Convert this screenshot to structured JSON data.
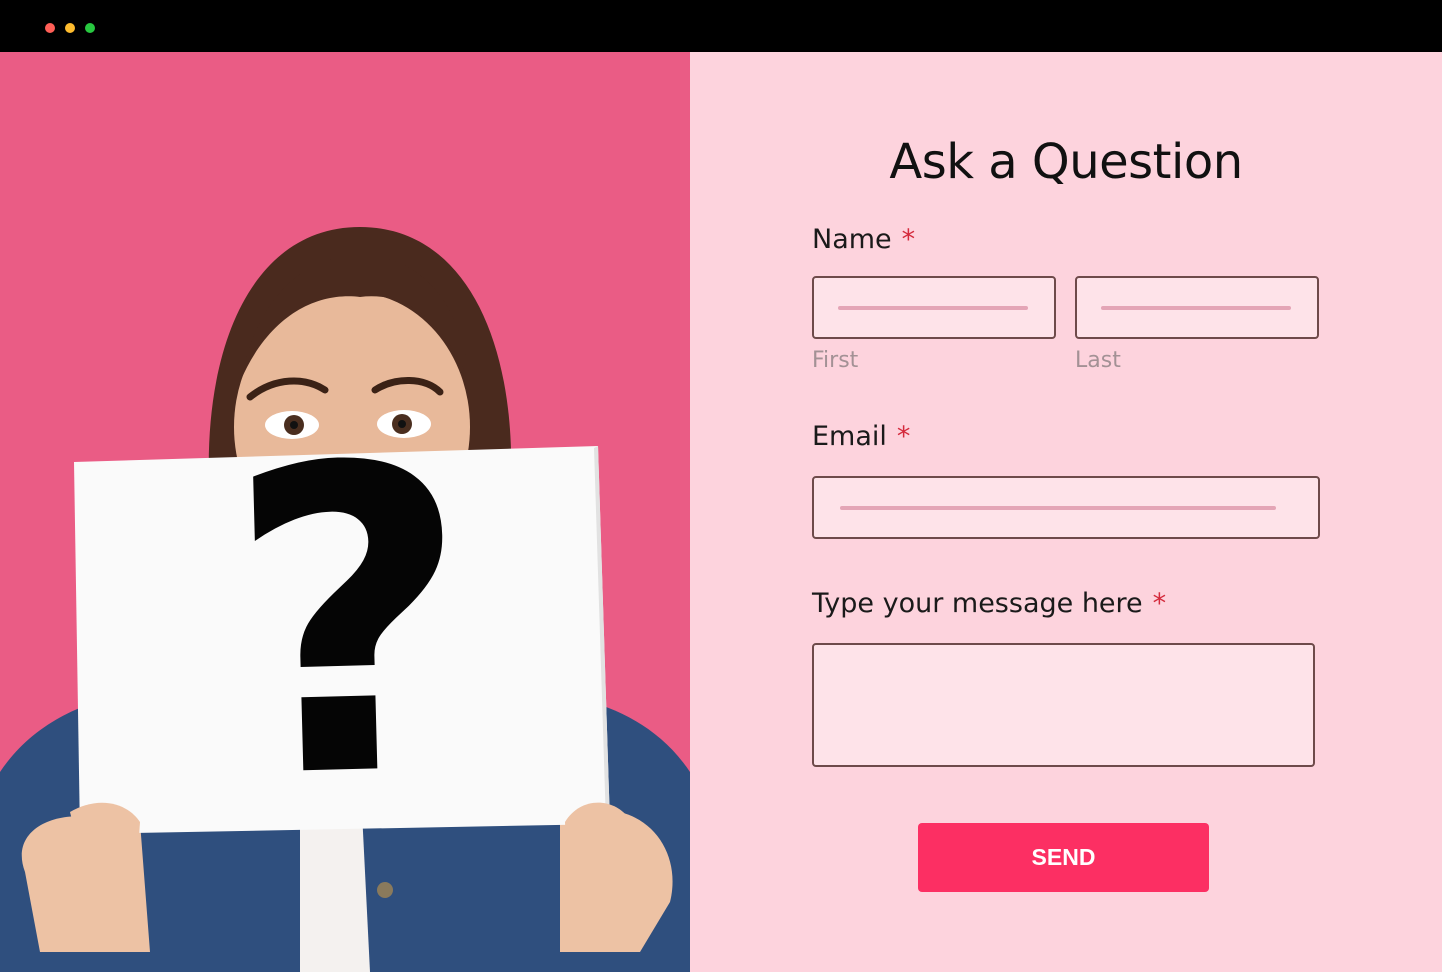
{
  "window": {
    "controls": [
      "close",
      "minimize",
      "maximize"
    ],
    "control_colors": {
      "close": "#ff5f57",
      "minimize": "#febc2e",
      "maximize": "#28c840"
    }
  },
  "colors": {
    "photo_background": "#ea5c85",
    "form_background": "#fdd3dd",
    "input_fill": "#fee3e9",
    "input_placeholder_line": "#e4a5b6",
    "required_marker": "#d42a3c",
    "button": "#fc2f63"
  },
  "hero": {
    "icon": "question-mark-sign-icon",
    "glyph": "?"
  },
  "form": {
    "title": "Ask a Question",
    "required_marker": "*",
    "name": {
      "label": "Name",
      "first_sublabel": "First",
      "last_sublabel": "Last",
      "first_value": "",
      "last_value": ""
    },
    "email": {
      "label": "Email",
      "value": ""
    },
    "message": {
      "label": "Type your message here",
      "value": ""
    },
    "submit_label": "SEND"
  }
}
